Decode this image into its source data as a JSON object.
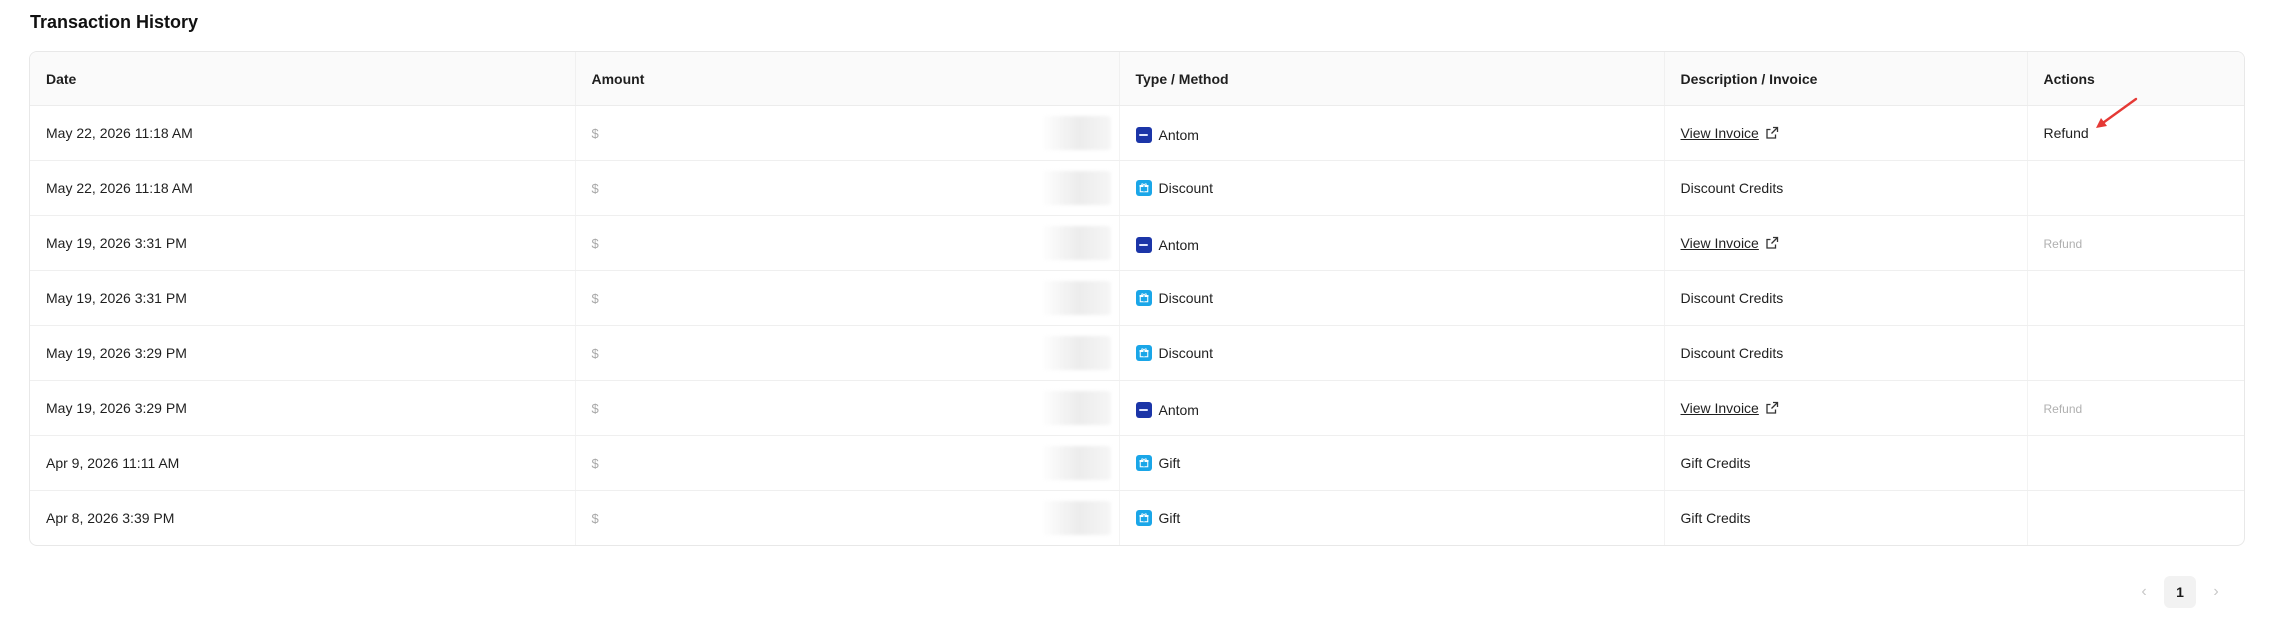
{
  "page": {
    "title": "Transaction History"
  },
  "table": {
    "headers": [
      "Date",
      "Amount",
      "Type / Method",
      "Description / Invoice",
      "Actions"
    ],
    "rows": [
      {
        "date": "May 22, 2026 11:18 AM",
        "amount": "$",
        "method": "Antom",
        "method_icon": "antom-icon",
        "description": "View Invoice",
        "is_invoice": true,
        "action": "Refund",
        "action_enabled": true
      },
      {
        "date": "May 22, 2026 11:18 AM",
        "amount": "$",
        "method": "Discount",
        "method_icon": "gift-icon",
        "description": "Discount Credits",
        "is_invoice": false,
        "action": "",
        "action_enabled": false
      },
      {
        "date": "May 19, 2026 3:31 PM",
        "amount": "$",
        "method": "Antom",
        "method_icon": "antom-icon",
        "description": "View Invoice",
        "is_invoice": true,
        "action": "Refund",
        "action_enabled": false
      },
      {
        "date": "May 19, 2026 3:31 PM",
        "amount": "$",
        "method": "Discount",
        "method_icon": "gift-icon",
        "description": "Discount Credits",
        "is_invoice": false,
        "action": "",
        "action_enabled": false
      },
      {
        "date": "May 19, 2026 3:29 PM",
        "amount": "$",
        "method": "Discount",
        "method_icon": "gift-icon",
        "description": "Discount Credits",
        "is_invoice": false,
        "action": "",
        "action_enabled": false
      },
      {
        "date": "May 19, 2026 3:29 PM",
        "amount": "$",
        "method": "Antom",
        "method_icon": "antom-icon",
        "description": "View Invoice",
        "is_invoice": true,
        "action": "Refund",
        "action_enabled": false
      },
      {
        "date": "Apr 9, 2026 11:11 AM",
        "amount": "$",
        "method": "Gift",
        "method_icon": "gift-icon",
        "description": "Gift Credits",
        "is_invoice": false,
        "action": "",
        "action_enabled": false
      },
      {
        "date": "Apr 8, 2026 3:39 PM",
        "amount": "$",
        "method": "Gift",
        "method_icon": "gift-icon",
        "description": "Gift Credits",
        "is_invoice": false,
        "action": "",
        "action_enabled": false
      }
    ]
  },
  "pagination": {
    "prev_icon": "chevron-left-icon",
    "current_page": "1",
    "next_icon": "chevron-right-icon"
  },
  "colors": {
    "antom_brand": "#1b35a8",
    "gift_brand": "#1aa6e8",
    "annotation_arrow": "#e53935",
    "disabled_text": "#b0b0b0"
  }
}
